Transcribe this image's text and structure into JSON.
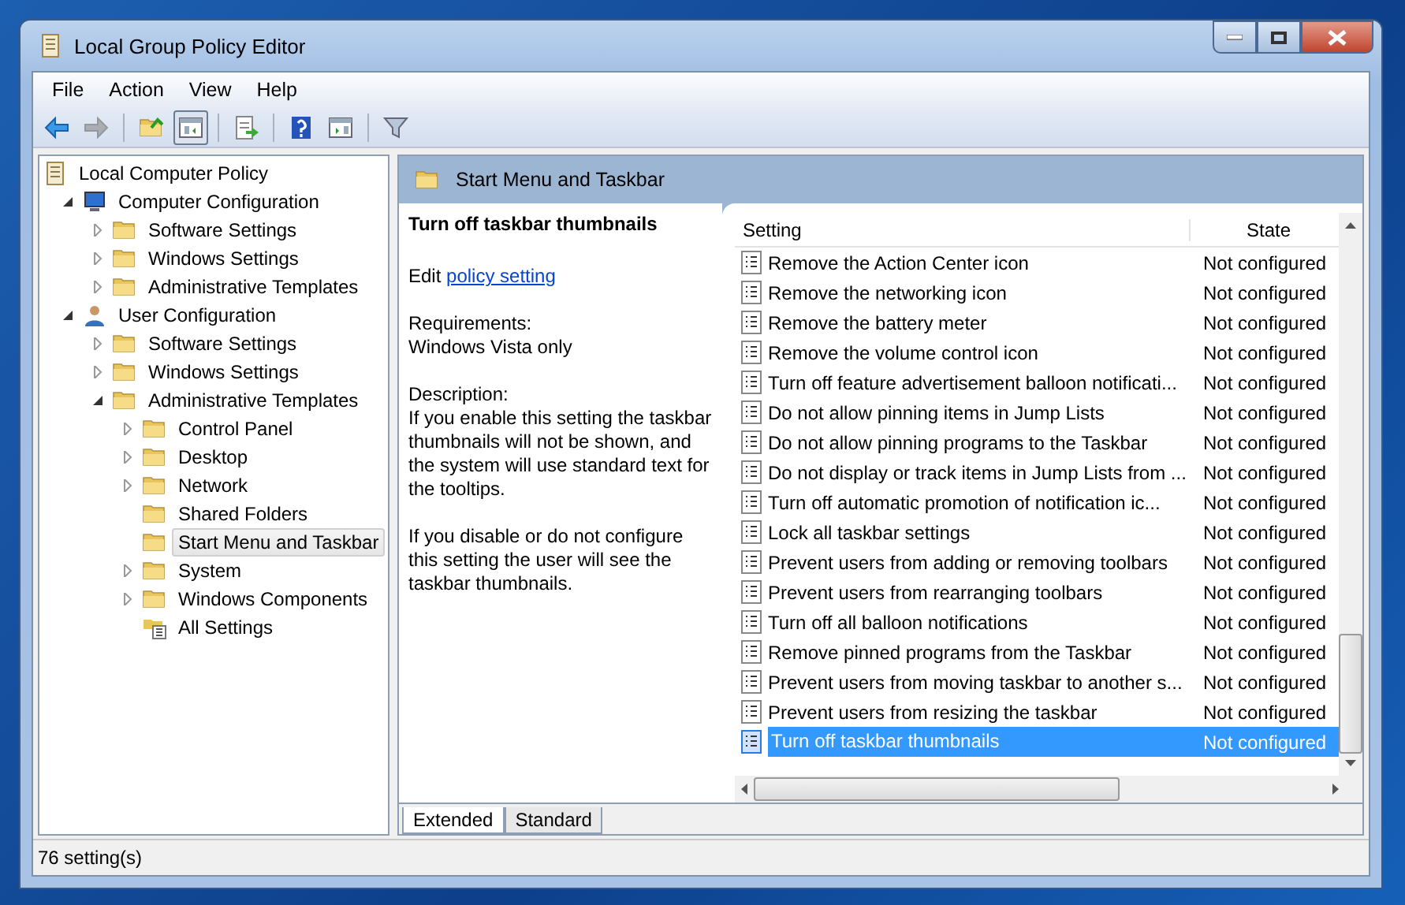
{
  "window": {
    "title": "Local Group Policy Editor"
  },
  "menu": [
    "File",
    "Action",
    "View",
    "Help"
  ],
  "toolbar": [
    {
      "kind": "back",
      "disabled": false,
      "pressed": false
    },
    {
      "kind": "forward",
      "disabled": true,
      "pressed": false
    },
    {
      "kind": "sep"
    },
    {
      "kind": "up",
      "disabled": false,
      "pressed": false
    },
    {
      "kind": "tree",
      "disabled": false,
      "pressed": true
    },
    {
      "kind": "sep"
    },
    {
      "kind": "export",
      "disabled": false,
      "pressed": false
    },
    {
      "kind": "sep"
    },
    {
      "kind": "help",
      "disabled": false,
      "pressed": false
    },
    {
      "kind": "action",
      "disabled": false,
      "pressed": false
    },
    {
      "kind": "sep"
    },
    {
      "kind": "filter",
      "disabled": false,
      "pressed": false
    }
  ],
  "tree": [
    {
      "label": "Local Computer Policy",
      "kind": "policy",
      "selected": false,
      "children": [
        {
          "label": "Computer Configuration",
          "kind": "computer",
          "selected": false,
          "expanded": true,
          "children": [
            {
              "label": "Software Settings",
              "kind": "folder",
              "selected": false,
              "expanded": false
            },
            {
              "label": "Windows Settings",
              "kind": "folder",
              "selected": false,
              "expanded": false
            },
            {
              "label": "Administrative Templates",
              "kind": "folder",
              "selected": false,
              "expanded": false
            }
          ]
        },
        {
          "label": "User Configuration",
          "kind": "user",
          "selected": false,
          "expanded": true,
          "children": [
            {
              "label": "Software Settings",
              "kind": "folder",
              "selected": false,
              "expanded": false
            },
            {
              "label": "Windows Settings",
              "kind": "folder",
              "selected": false,
              "expanded": false
            },
            {
              "label": "Administrative Templates",
              "kind": "folder",
              "selected": false,
              "expanded": true,
              "children": [
                {
                  "label": "Control Panel",
                  "kind": "folder",
                  "selected": false,
                  "expanded": false
                },
                {
                  "label": "Desktop",
                  "kind": "folder",
                  "selected": false,
                  "expanded": false
                },
                {
                  "label": "Network",
                  "kind": "folder",
                  "selected": false,
                  "expanded": false
                },
                {
                  "label": "Shared Folders",
                  "kind": "folder",
                  "selected": false
                },
                {
                  "label": "Start Menu and Taskbar",
                  "kind": "folder",
                  "selected": true
                },
                {
                  "label": "System",
                  "kind": "folder",
                  "selected": false,
                  "expanded": false
                },
                {
                  "label": "Windows Components",
                  "kind": "folder",
                  "selected": false,
                  "expanded": false
                },
                {
                  "label": "All Settings",
                  "kind": "all-settings",
                  "selected": false
                }
              ]
            }
          ]
        }
      ]
    }
  ],
  "panel": {
    "title": "Start Menu and Taskbar"
  },
  "details": {
    "title": "Turn off taskbar thumbnails",
    "edit_prefix": "Edit",
    "edit_link": "policy setting",
    "requirements_label": "Requirements:",
    "requirements": "Windows Vista only",
    "description_label": "Description:",
    "description": [
      "If you enable this setting the taskbar thumbnails will not be shown, and the system will use standard text for the tooltips.",
      "If you disable or do not configure this setting the user will see the taskbar thumbnails."
    ]
  },
  "table": {
    "columns": [
      "Setting",
      "State"
    ],
    "rows": [
      {
        "setting": "Remove the Action Center icon",
        "state": "Not configured",
        "selected": false
      },
      {
        "setting": "Remove the networking icon",
        "state": "Not configured",
        "selected": false
      },
      {
        "setting": "Remove the battery meter",
        "state": "Not configured",
        "selected": false
      },
      {
        "setting": "Remove the volume control icon",
        "state": "Not configured",
        "selected": false
      },
      {
        "setting": "Turn off feature advertisement balloon notificati...",
        "state": "Not configured",
        "selected": false
      },
      {
        "setting": "Do not allow pinning items in Jump Lists",
        "state": "Not configured",
        "selected": false
      },
      {
        "setting": "Do not allow pinning programs to the Taskbar",
        "state": "Not configured",
        "selected": false
      },
      {
        "setting": "Do not display or track items in Jump Lists from ...",
        "state": "Not configured",
        "selected": false
      },
      {
        "setting": "Turn off automatic promotion of notification ic...",
        "state": "Not configured",
        "selected": false
      },
      {
        "setting": "Lock all taskbar settings",
        "state": "Not configured",
        "selected": false
      },
      {
        "setting": "Prevent users from adding or removing toolbars",
        "state": "Not configured",
        "selected": false
      },
      {
        "setting": "Prevent users from rearranging toolbars",
        "state": "Not configured",
        "selected": false
      },
      {
        "setting": "Turn off all balloon notifications",
        "state": "Not configured",
        "selected": false
      },
      {
        "setting": "Remove pinned programs from the Taskbar",
        "state": "Not configured",
        "selected": false
      },
      {
        "setting": "Prevent users from moving taskbar to another s...",
        "state": "Not configured",
        "selected": false
      },
      {
        "setting": "Prevent users from resizing the taskbar",
        "state": "Not configured",
        "selected": false
      },
      {
        "setting": "Turn off taskbar thumbnails",
        "state": "Not configured",
        "selected": true
      }
    ]
  },
  "view_tabs": [
    {
      "label": "Extended",
      "selected": true
    },
    {
      "label": "Standard",
      "selected": false
    }
  ],
  "status_bar": "76 setting(s)"
}
